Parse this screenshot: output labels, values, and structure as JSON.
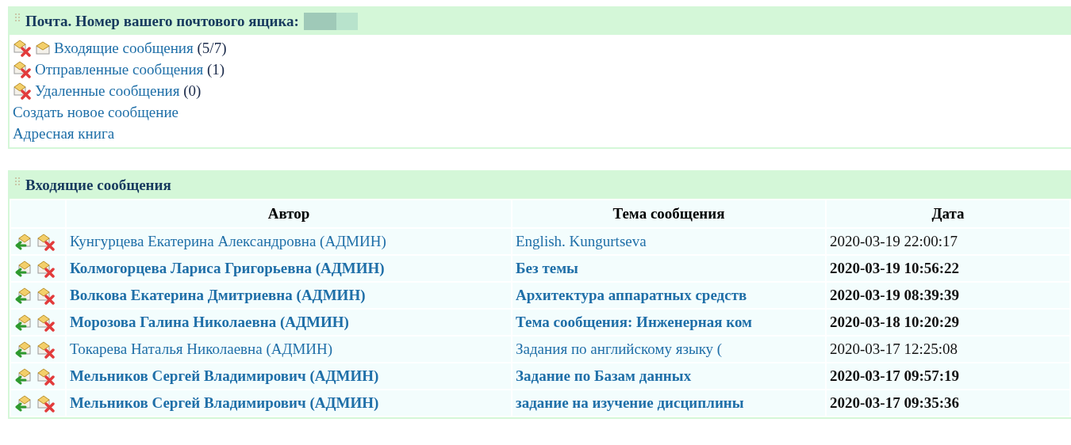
{
  "mail_panel": {
    "title": "Почта. Номер вашего почтового ящика:",
    "folders": [
      {
        "kind": "inbox",
        "label": "Входящие сообщения",
        "count": "(5/7)"
      },
      {
        "kind": "folder",
        "label": "Отправленные сообщения",
        "count": "(1)"
      },
      {
        "kind": "folder",
        "label": "Удаленные сообщения",
        "count": "(0)"
      }
    ],
    "links": [
      "Создать новое сообщение",
      "Адресная книга"
    ]
  },
  "inbox_panel": {
    "title": "Входящие сообщения",
    "table": {
      "columns": [
        "Автор",
        "Тема сообщения",
        "Дата"
      ],
      "rows": [
        {
          "unread": false,
          "author": "Кунгурцева Екатерина Александровна (АДМИН)",
          "subject": "English. Kungurtseva",
          "date": "2020-03-19 22:00:17"
        },
        {
          "unread": true,
          "author": "Колмогорцева Лариса Григорьевна (АДМИН)",
          "subject": "Без темы",
          "date": "2020-03-19 10:56:22"
        },
        {
          "unread": true,
          "author": "Волкова Екатерина Дмитриевна (АДМИН)",
          "subject": "Архитектура аппаратных средств",
          "date": "2020-03-19 08:39:39"
        },
        {
          "unread": true,
          "author": "Морозова Галина Николаевна (АДМИН)",
          "subject": "Тема сообщения: Инженерная ком",
          "date": "2020-03-18 10:20:29"
        },
        {
          "unread": false,
          "author": "Токарева Наталья Николаевна (АДМИН)",
          "subject": "Задания по английскому языку (",
          "date": "2020-03-17 12:25:08"
        },
        {
          "unread": true,
          "author": "Мельников Сергей Владимирович (АДМИН)",
          "subject": "Задание по Базам данных",
          "date": "2020-03-17 09:57:19"
        },
        {
          "unread": true,
          "author": "Мельников Сергей Владимирович (АДМИН)",
          "subject": "задание на изучение дисциплины",
          "date": "2020-03-17 09:35:36"
        }
      ]
    }
  }
}
